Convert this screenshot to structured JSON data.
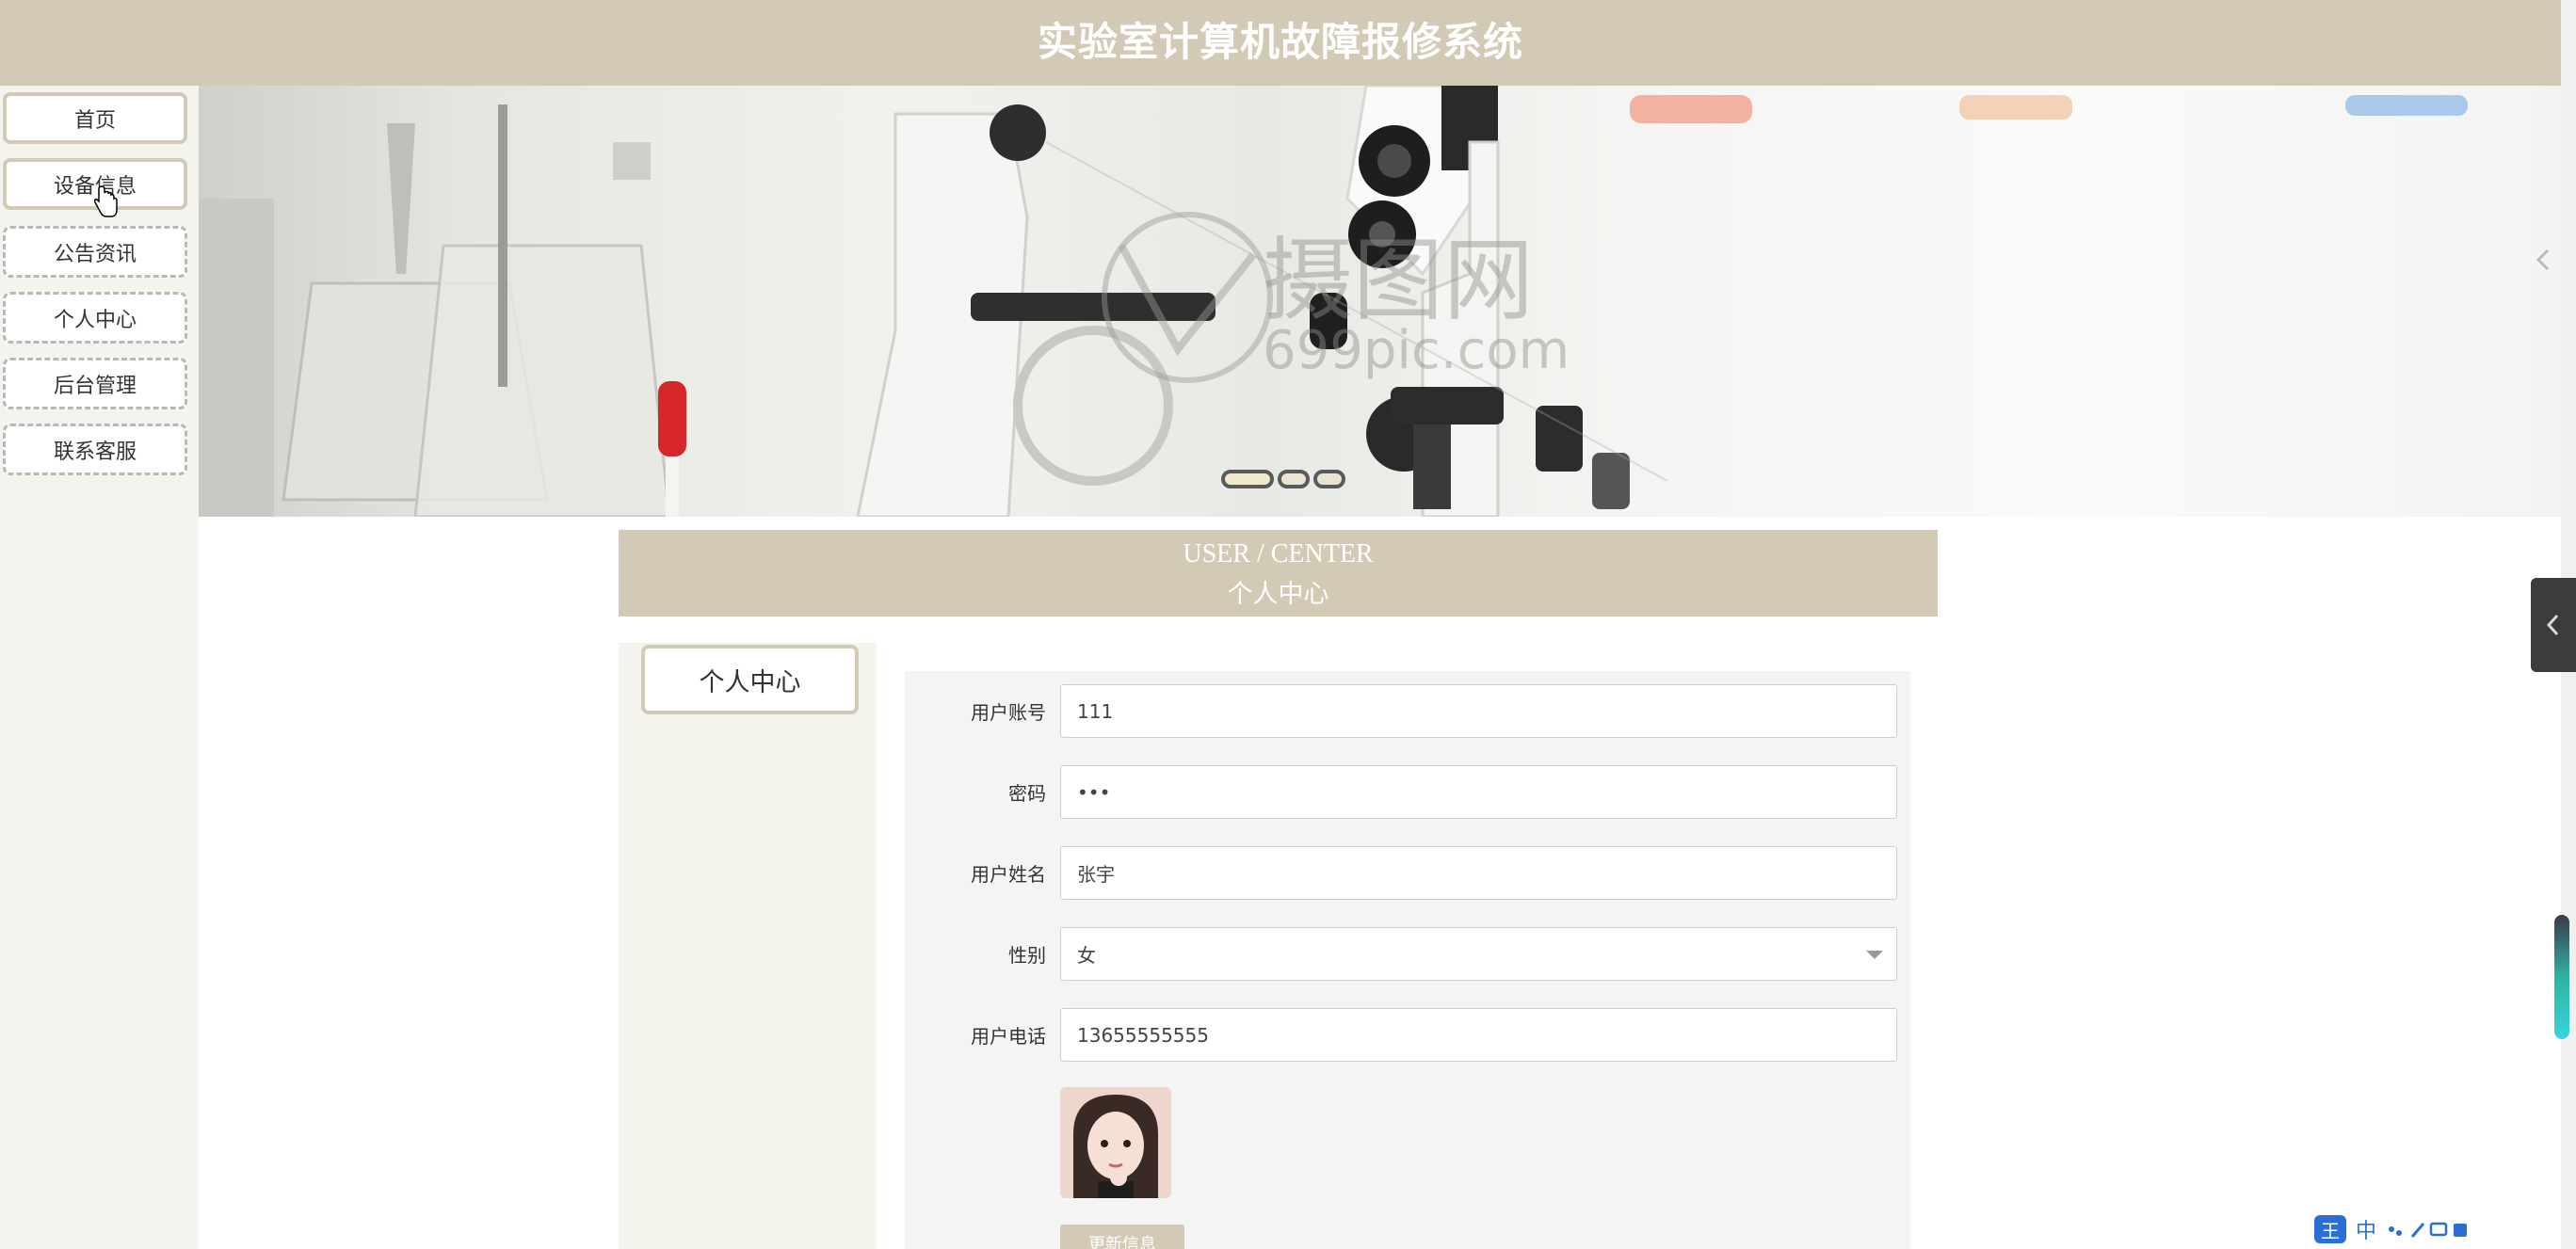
{
  "header": {
    "title": "实验室计算机故障报修系统"
  },
  "nav": {
    "items": [
      {
        "label": "首页"
      },
      {
        "label": "设备信息"
      },
      {
        "label": "公告资讯"
      },
      {
        "label": "个人中心"
      },
      {
        "label": "后台管理"
      },
      {
        "label": "联系客服"
      }
    ]
  },
  "banner": {
    "watermark_cn": "摄图网",
    "watermark_en": "699pic.com",
    "slide_count": 3,
    "active_slide": 1
  },
  "section": {
    "title_en": "USER / CENTER",
    "title_cn": "个人中心"
  },
  "side_panel": {
    "button_label": "个人中心"
  },
  "form": {
    "fields": [
      {
        "label": "用户账号",
        "value": "111"
      },
      {
        "label": "密码",
        "value": "•••"
      },
      {
        "label": "用户姓名",
        "value": "张宇"
      },
      {
        "label": "性别",
        "value": "女"
      },
      {
        "label": "用户电话",
        "value": "13655555555"
      }
    ],
    "submit_label": "更新信息"
  },
  "tray": {
    "logo": "王",
    "ime": "中"
  },
  "colors": {
    "accent": "#d3cab6",
    "panel": "#f4f4ec",
    "form_bg": "#f4f4f4"
  },
  "icons": [
    "cursor-icon",
    "chevron-left-icon",
    "caret-down-icon",
    "avatar-image",
    "ime-icon"
  ]
}
